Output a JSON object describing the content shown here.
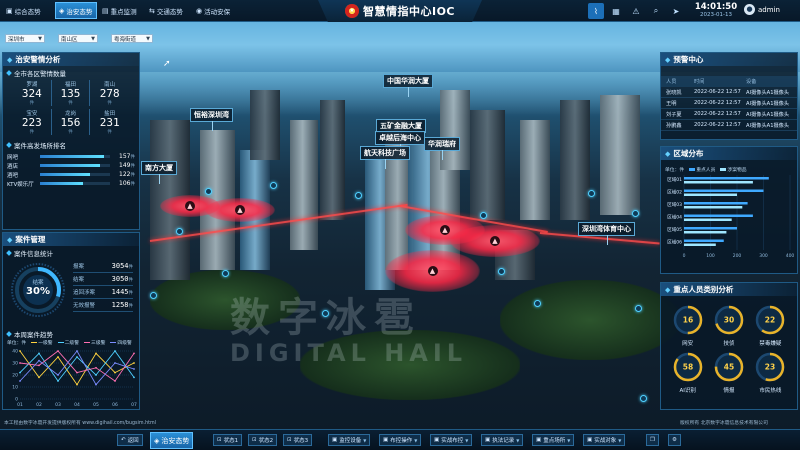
{
  "topbar": {
    "tabs": [
      {
        "icon": "▣",
        "label": "综合态势",
        "active": false
      },
      {
        "icon": "◈",
        "label": "治安态势",
        "active": true
      },
      {
        "icon": "▤",
        "label": "重点监测",
        "active": false
      },
      {
        "icon": "⇆",
        "label": "交通态势",
        "active": false
      },
      {
        "icon": "◉",
        "label": "活动安保",
        "active": false
      }
    ],
    "title": "智慧情指中心IOC",
    "emblem_icon": "police-emblem",
    "time": "14:01:50",
    "date": "2023-01-13",
    "user": "admin"
  },
  "filters": [
    {
      "value": "深圳市"
    },
    {
      "value": "南山区"
    },
    {
      "value": "粤海街道"
    }
  ],
  "left_panel": {
    "title": "治安警情分析",
    "stats_title": "全市各区警情数量",
    "stats": [
      {
        "label": "罗湖",
        "value": "324",
        "unit": "件"
      },
      {
        "label": "福田",
        "value": "135",
        "unit": "件"
      },
      {
        "label": "南山",
        "value": "278",
        "unit": "件"
      },
      {
        "label": "宝安",
        "value": "223",
        "unit": "件"
      },
      {
        "label": "龙岗",
        "value": "156",
        "unit": "件"
      },
      {
        "label": "盐田",
        "value": "231",
        "unit": "件"
      }
    ],
    "rank_title": "案件高发场所排名",
    "rank": [
      {
        "name": "网吧",
        "value": "157",
        "unit": "件",
        "pct": 0.92
      },
      {
        "name": "酒店",
        "value": "149",
        "unit": "件",
        "pct": 0.86
      },
      {
        "name": "酒吧",
        "value": "122",
        "unit": "件",
        "pct": 0.72
      },
      {
        "name": "KTV娱乐厅",
        "value": "106",
        "unit": "件",
        "pct": 0.62
      }
    ]
  },
  "case_panel": {
    "title": "案件管理",
    "info_title": "案件信息统计",
    "gauge_label": "结案",
    "gauge_value": "30%",
    "gauge_pct": 0.3,
    "items": [
      {
        "label": "报案",
        "value": "3054",
        "unit": "件"
      },
      {
        "label": "结案",
        "value": "3050",
        "unit": "件"
      },
      {
        "label": "追回涉案",
        "value": "1445",
        "unit": "件"
      },
      {
        "label": "无效报警",
        "value": "1258",
        "unit": "件"
      }
    ],
    "trend_title": "本周案件趋势"
  },
  "chart_data": {
    "type": "line",
    "unit": "单位：件",
    "series": [
      {
        "name": "一级警",
        "color": "#ffd23f",
        "values": [
          40,
          18,
          35,
          12,
          38,
          22,
          30
        ]
      },
      {
        "name": "二级警",
        "color": "#4fd0ff",
        "values": [
          22,
          38,
          15,
          35,
          20,
          40,
          18
        ]
      },
      {
        "name": "三级警",
        "color": "#ff6fb2",
        "values": [
          30,
          28,
          40,
          22,
          26,
          15,
          38
        ]
      },
      {
        "name": "四级警",
        "color": "#7b8cff",
        "values": [
          15,
          32,
          20,
          40,
          12,
          30,
          25
        ]
      }
    ],
    "categories": [
      "01",
      "02",
      "03",
      "04",
      "05",
      "06",
      "07"
    ],
    "ylim": [
      0,
      40
    ],
    "yticks": [
      "40",
      "30",
      "20",
      "10",
      "0"
    ]
  },
  "right_panel": {
    "alert_title": "预警中心",
    "alert_columns": [
      "人员",
      "时间",
      "设备"
    ],
    "alerts": [
      {
        "person": "张晓凯",
        "time": "2022-06-22 12:57",
        "device": "AI摄像头A1摄像头"
      },
      {
        "person": "王明",
        "time": "2022-06-22 12:57",
        "device": "AI摄像头A1摄像头"
      },
      {
        "person": "刘子夏",
        "time": "2022-06-22 12:57",
        "device": "AI摄像头A1摄像头"
      },
      {
        "person": "孙鹏鑫",
        "time": "2022-06-22 12:57",
        "device": "AI摄像头A1摄像头"
      }
    ],
    "dist_title": "区域分布",
    "dist_unit": "单位：件",
    "dist_legend": [
      "重点人员",
      "涉案物品"
    ],
    "dist_rows": [
      {
        "name": "区域01",
        "a": 320,
        "b": 260
      },
      {
        "name": "区域02",
        "a": 300,
        "b": 200
      },
      {
        "name": "区域03",
        "a": 240,
        "b": 220
      },
      {
        "name": "区域04",
        "a": 260,
        "b": 180
      },
      {
        "name": "区域05",
        "a": 200,
        "b": 160
      },
      {
        "name": "区域06",
        "a": 150,
        "b": 120
      }
    ],
    "dist_xticks": [
      "0",
      "100",
      "200",
      "300",
      "400"
    ],
    "people_title": "重点人员类别分析",
    "people": [
      {
        "label": "网安",
        "value": "16",
        "pct": 0.5
      },
      {
        "label": "技侦",
        "value": "30",
        "pct": 0.7
      },
      {
        "label": "禁毒嫌疑",
        "value": "22",
        "pct": 0.6
      },
      {
        "label": "AI识别",
        "value": "58",
        "pct": 0.85
      },
      {
        "label": "情报",
        "value": "45",
        "pct": 0.75
      },
      {
        "label": "市民热线",
        "value": "23",
        "pct": 0.55
      }
    ]
  },
  "map": {
    "labels": [
      "中国华润大厦",
      "恒裕深圳湾",
      "五矿金融大厦",
      "卓越后海中心",
      "华润瑞府",
      "航天科技广场",
      "南方大厦",
      "深圳湾体育中心"
    ],
    "watermark_cn": "数字冰雹",
    "watermark_en": "DIGITAL HAIL"
  },
  "footer": {
    "left": "本工程由数字冰雹开发提供版权所有 www.digihail.com/bugsim.html",
    "right": "版权所有 北京数字冰雹信息技术有限公司"
  },
  "bottombar": {
    "back": "返回",
    "active": "治安态势",
    "states": [
      "状态1",
      "状态2",
      "状态3"
    ],
    "buttons": [
      "监控设备",
      "布控操作",
      "实战布控",
      "执法记录",
      "重点场所",
      "实战对象"
    ]
  }
}
